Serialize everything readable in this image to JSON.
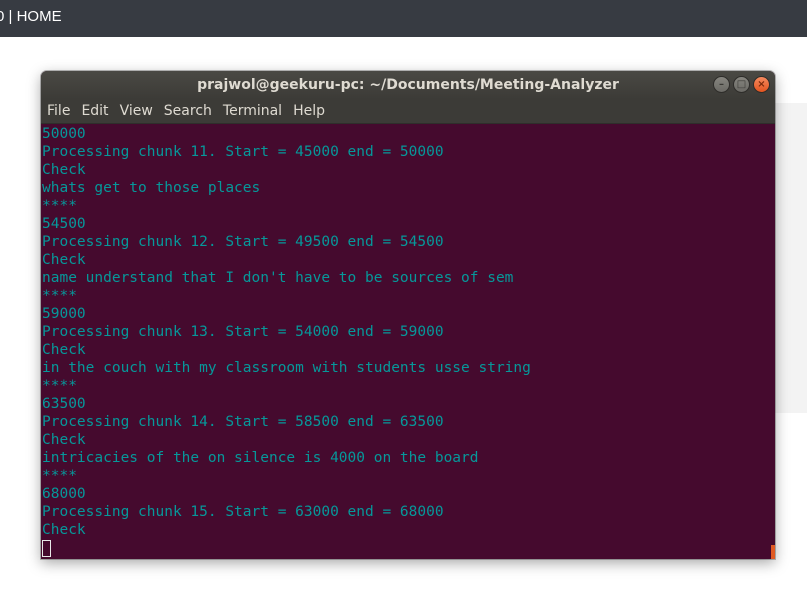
{
  "top_bar": {
    "text": "0 | HOME"
  },
  "window": {
    "title": "prajwol@geekuru-pc: ~/Documents/Meeting-Analyzer",
    "controls": {
      "minimize": "–",
      "maximize": "□",
      "close": "×"
    }
  },
  "menu": [
    "File",
    "Edit",
    "View",
    "Search",
    "Terminal",
    "Help"
  ],
  "terminal": {
    "lines": [
      "50000",
      "Processing chunk 11. Start = 45000 end = 50000",
      "Check",
      "whats get to those places",
      "****",
      "54500",
      "Processing chunk 12. Start = 49500 end = 54500",
      "Check",
      "name understand that I don't have to be sources of sem",
      "****",
      "59000",
      "Processing chunk 13. Start = 54000 end = 59000",
      "Check",
      "in the couch with my classroom with students usse string",
      "****",
      "63500",
      "Processing chunk 14. Start = 58500 end = 63500",
      "Check",
      "intricacies of the on silence is 4000 on the board",
      "****",
      "68000",
      "Processing chunk 15. Start = 63000 end = 68000",
      "Check"
    ],
    "colors": {
      "background": "#450a2e",
      "text": "#06989a"
    }
  }
}
